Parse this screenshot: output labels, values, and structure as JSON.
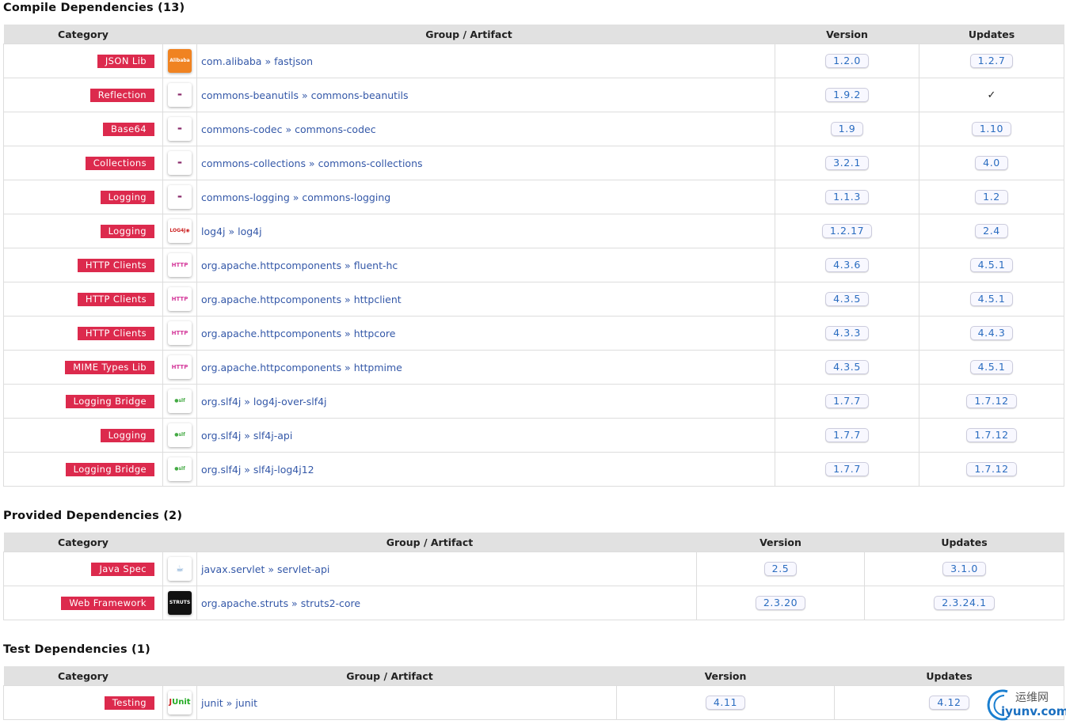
{
  "headers": {
    "category": "Category",
    "artifact": "Group / Artifact",
    "version": "Version",
    "updates": "Updates"
  },
  "sections": [
    {
      "title": "Compile Dependencies (13)",
      "rows": [
        {
          "category": "JSON Lib",
          "logo": "alibaba",
          "group": "com.alibaba",
          "artifact": "fastjson",
          "version": "1.2.0",
          "update": "1.2.7"
        },
        {
          "category": "Reflection",
          "logo": "apache",
          "group": "commons-beanutils",
          "artifact": "commons-beanutils",
          "version": "1.9.2",
          "update": "✓"
        },
        {
          "category": "Base64",
          "logo": "apache",
          "group": "commons-codec",
          "artifact": "commons-codec",
          "version": "1.9",
          "update": "1.10"
        },
        {
          "category": "Collections",
          "logo": "apache",
          "group": "commons-collections",
          "artifact": "commons-collections",
          "version": "3.2.1",
          "update": "4.0"
        },
        {
          "category": "Logging",
          "logo": "apache",
          "group": "commons-logging",
          "artifact": "commons-logging",
          "version": "1.1.3",
          "update": "1.2"
        },
        {
          "category": "Logging",
          "logo": "log4j",
          "group": "log4j",
          "artifact": "log4j",
          "version": "1.2.17",
          "update": "2.4"
        },
        {
          "category": "HTTP Clients",
          "logo": "http",
          "group": "org.apache.httpcomponents",
          "artifact": "fluent-hc",
          "version": "4.3.6",
          "update": "4.5.1"
        },
        {
          "category": "HTTP Clients",
          "logo": "http",
          "group": "org.apache.httpcomponents",
          "artifact": "httpclient",
          "version": "4.3.5",
          "update": "4.5.1"
        },
        {
          "category": "HTTP Clients",
          "logo": "http",
          "group": "org.apache.httpcomponents",
          "artifact": "httpcore",
          "version": "4.3.3",
          "update": "4.4.3"
        },
        {
          "category": "MIME Types Lib",
          "logo": "http",
          "group": "org.apache.httpcomponents",
          "artifact": "httpmime",
          "version": "4.3.5",
          "update": "4.5.1"
        },
        {
          "category": "Logging Bridge",
          "logo": "slf4j",
          "group": "org.slf4j",
          "artifact": "log4j-over-slf4j",
          "version": "1.7.7",
          "update": "1.7.12"
        },
        {
          "category": "Logging",
          "logo": "slf4j",
          "group": "org.slf4j",
          "artifact": "slf4j-api",
          "version": "1.7.7",
          "update": "1.7.12"
        },
        {
          "category": "Logging Bridge",
          "logo": "slf4j",
          "group": "org.slf4j",
          "artifact": "slf4j-log4j12",
          "version": "1.7.7",
          "update": "1.7.12"
        }
      ]
    },
    {
      "title": "Provided Dependencies (2)",
      "rows": [
        {
          "category": "Java Spec",
          "logo": "java",
          "group": "javax.servlet",
          "artifact": "servlet-api",
          "version": "2.5",
          "update": "3.1.0"
        },
        {
          "category": "Web Framework",
          "logo": "struts",
          "group": "org.apache.struts",
          "artifact": "struts2-core",
          "version": "2.3.20",
          "update": "2.3.24.1"
        }
      ]
    },
    {
      "title": "Test Dependencies (1)",
      "rows": [
        {
          "category": "Testing",
          "logo": "junit",
          "group": "junit",
          "artifact": "junit",
          "version": "4.11",
          "update": "4.12"
        }
      ]
    }
  ],
  "watermark": {
    "cn": "运维网",
    "url": "iyunv.com"
  },
  "colors": {
    "badge": "#dc2a4d",
    "link": "#3458a8",
    "pill_text": "#2a6cc0",
    "header_bg": "#e1e1e1"
  }
}
